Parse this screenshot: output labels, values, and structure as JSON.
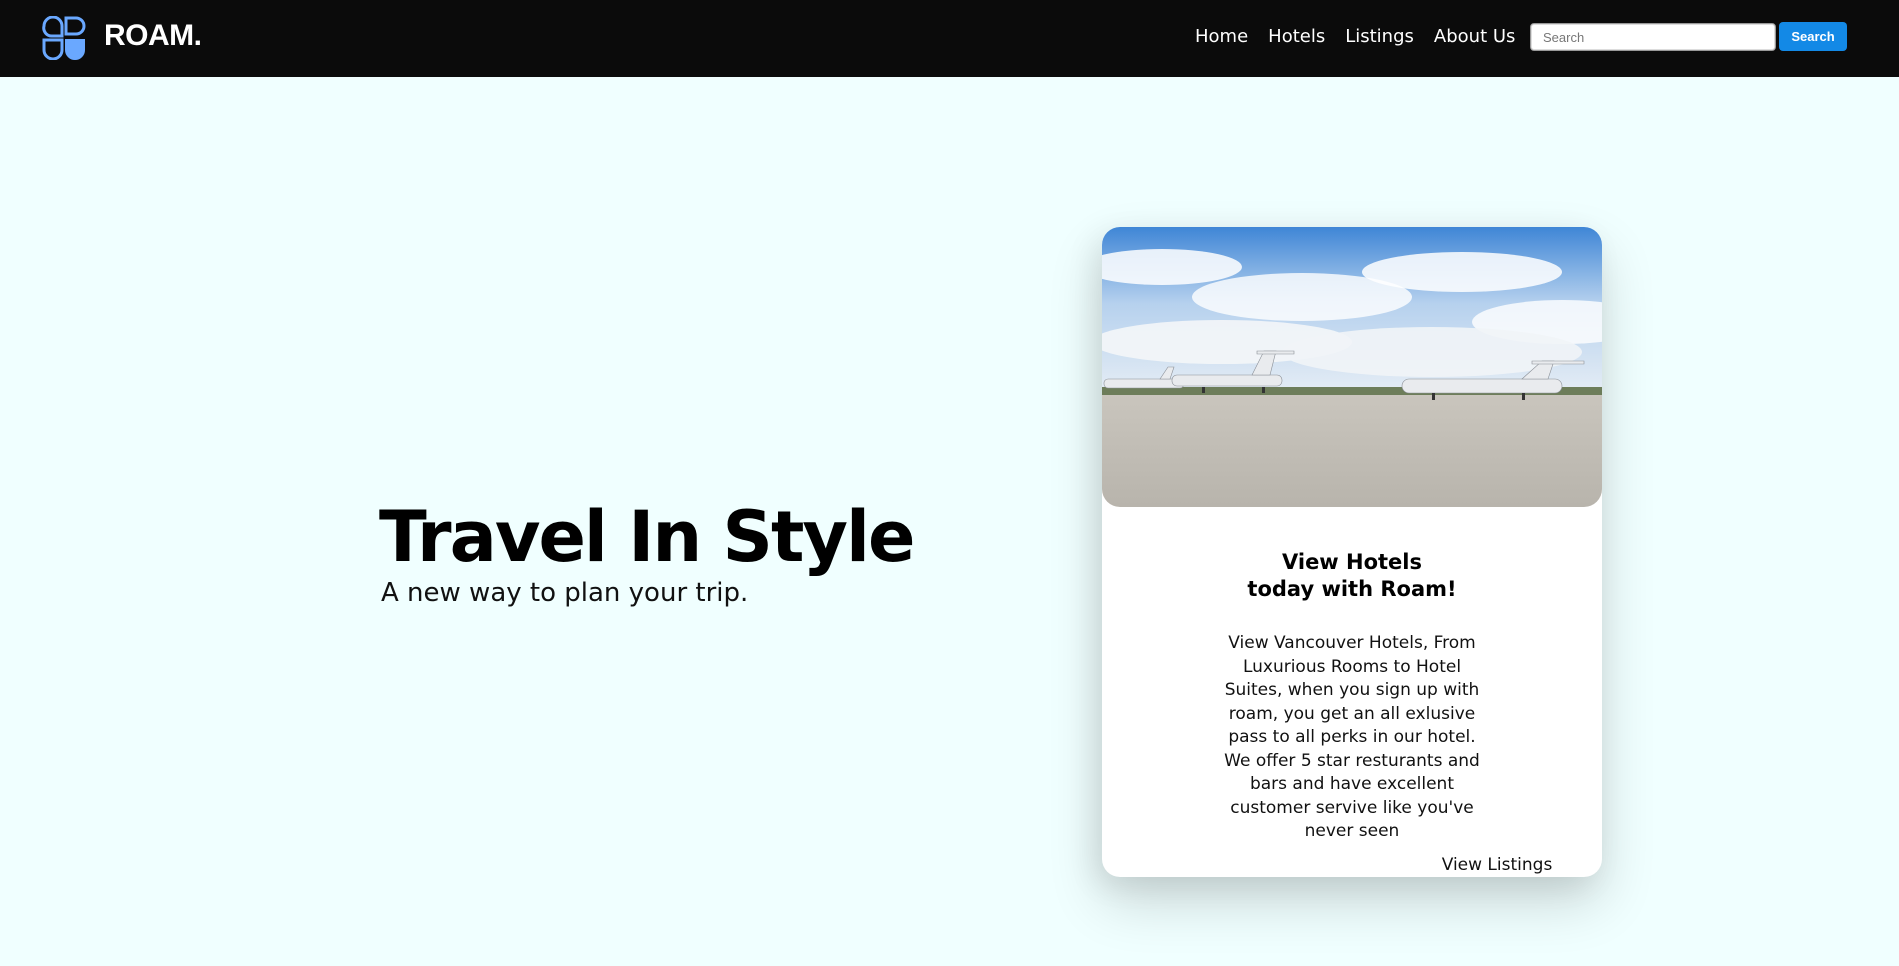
{
  "header": {
    "logo_icon": "petal-grid-logo-icon",
    "brand": "ROAM.",
    "nav": [
      "Home",
      "Hotels",
      "Listings",
      "About Us"
    ],
    "search": {
      "placeholder": "Search",
      "button_label": "Search"
    }
  },
  "hero": {
    "title": "Travel In Style",
    "subtitle": "A new way to plan your trip."
  },
  "card": {
    "image_icon": "private-jets-on-runway-photo",
    "title_line1": "View Hotels",
    "title_line2": "today with Roam!",
    "body": "View Vancouver Hotels, From Luxurious Rooms to Hotel Suites, when you sign up with roam, you get an all exlusive pass to all perks in our hotel. We offer 5 star resturants and bars and have excellent customer servive like you've never seen",
    "link_label": "View Listings"
  },
  "colors": {
    "page_background": "#f0ffff",
    "navbar_background": "#0b0b0b",
    "accent_blue": "#1389e6",
    "logo_blue": "#6aa8ff"
  }
}
